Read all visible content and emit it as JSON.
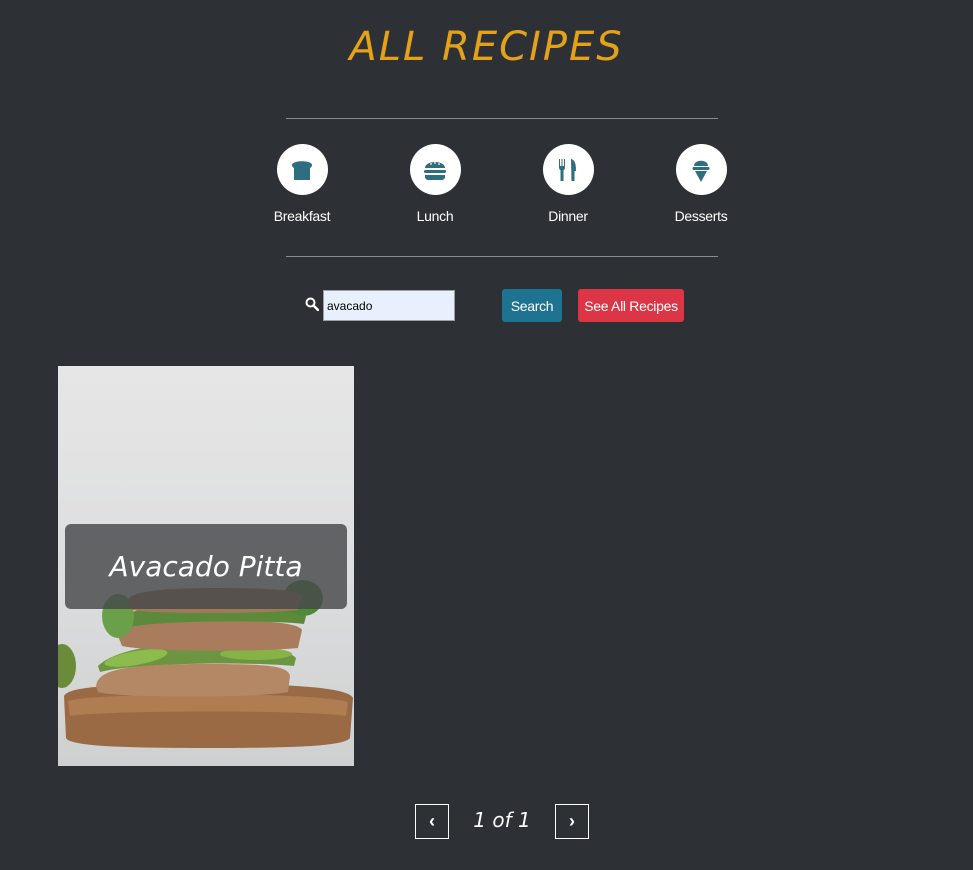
{
  "header": {
    "title": "ALL RECIPES"
  },
  "categories": [
    {
      "label": "Breakfast",
      "icon": "bread-icon"
    },
    {
      "label": "Lunch",
      "icon": "burger-icon"
    },
    {
      "label": "Dinner",
      "icon": "fork-knife-icon"
    },
    {
      "label": "Desserts",
      "icon": "ice-cream-icon"
    }
  ],
  "search": {
    "value": "avacado",
    "search_label": "Search",
    "see_all_label": "See All Recipes"
  },
  "recipes": [
    {
      "title": "Avacado Pitta"
    }
  ],
  "pagination": {
    "prev": "‹",
    "next": "›",
    "indicator": "1 of 1"
  },
  "colors": {
    "background": "#2d3035",
    "accent": "#e3a21a",
    "icon": "#2f6e80",
    "search_button": "#1e7490",
    "see_all_button": "#dc3545"
  }
}
